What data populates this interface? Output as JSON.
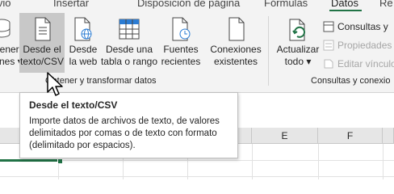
{
  "tabs": [
    {
      "label": "ivio"
    },
    {
      "label": "Insertar"
    },
    {
      "label": "Disposición de página"
    },
    {
      "label": "Fórmulas"
    },
    {
      "label": "Datos"
    },
    {
      "label": "Re"
    }
  ],
  "ribbon": {
    "obtener": {
      "line1": "tener",
      "line2": "ones ▾"
    },
    "desde_texto": {
      "line1": "Desde el",
      "line2": "texto/CSV"
    },
    "desde_web": {
      "line1": "Desde",
      "line2": "la web"
    },
    "desde_tabla": {
      "line1": "Desde una",
      "line2": "tabla o rango"
    },
    "fuentes": {
      "line1": "Fuentes",
      "line2": "recientes"
    },
    "conexiones": {
      "line1": "Conexiones",
      "line2": "existentes"
    },
    "actualizar": {
      "line1": "Actualizar",
      "line2": "todo ▾"
    },
    "consultas": "Consultas y",
    "propiedades": "Propiedades",
    "editar_vinculos": "Editar vínculo",
    "group_obtener": "Obtener y transformar datos",
    "group_consultas": "Consultas y conexio"
  },
  "tooltip": {
    "title": "Desde el texto/CSV",
    "body": "Importe datos de archivos de texto, de valores delimitados por comas o de texto con formato (delimitado por espacios)."
  },
  "sheet": {
    "columns": [
      "E",
      "F"
    ]
  }
}
